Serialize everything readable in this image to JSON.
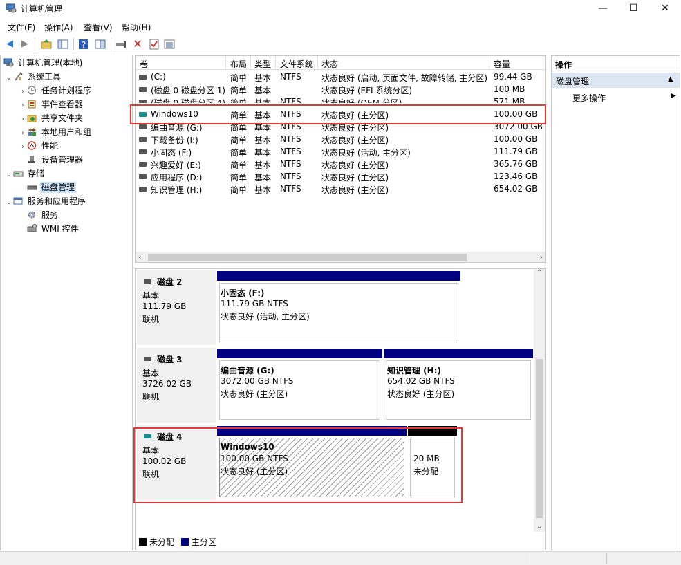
{
  "window": {
    "title": "计算机管理",
    "minimize": "—",
    "maximize": "☐",
    "close": "✕"
  },
  "menu": [
    "文件(F)",
    "操作(A)",
    "查看(V)",
    "帮助(H)"
  ],
  "tree": {
    "root": "计算机管理(本地)",
    "system_tools": "系统工具",
    "task_scheduler": "任务计划程序",
    "event_viewer": "事件查看器",
    "shared_folders": "共享文件夹",
    "local_users": "本地用户和组",
    "performance": "性能",
    "device_manager": "设备管理器",
    "storage": "存储",
    "disk_management": "磁盘管理",
    "services_apps": "服务和应用程序",
    "services": "服务",
    "wmi": "WMI 控件"
  },
  "volume_table": {
    "headers": [
      "卷",
      "布局",
      "类型",
      "文件系统",
      "状态",
      "容量"
    ],
    "rows": [
      {
        "vol": "(C:)",
        "layout": "简单",
        "type": "基本",
        "fs": "NTFS",
        "status": "状态良好 (启动, 页面文件, 故障转储, 主分区)",
        "cap": "99.44 GB"
      },
      {
        "vol": "(磁盘 0 磁盘分区 1)",
        "layout": "简单",
        "type": "基本",
        "fs": "",
        "status": "状态良好 (EFI 系统分区)",
        "cap": "100 MB"
      },
      {
        "vol": "(磁盘 0 磁盘分区 4)",
        "layout": "简单",
        "type": "基本",
        "fs": "NTFS",
        "status": "状态良好 (OEM 分区)",
        "cap": "571 MB"
      },
      {
        "vol": "Windows10",
        "layout": "简单",
        "type": "基本",
        "fs": "NTFS",
        "status": "状态良好 (主分区)",
        "cap": "100.00 GB"
      },
      {
        "vol": "编曲音源 (G:)",
        "layout": "简单",
        "type": "基本",
        "fs": "NTFS",
        "status": "状态良好 (主分区)",
        "cap": "3072.00 GB"
      },
      {
        "vol": "下载备份 (I:)",
        "layout": "简单",
        "type": "基本",
        "fs": "NTFS",
        "status": "状态良好 (主分区)",
        "cap": "100.00 GB"
      },
      {
        "vol": "小固态 (F:)",
        "layout": "简单",
        "type": "基本",
        "fs": "NTFS",
        "status": "状态良好 (活动, 主分区)",
        "cap": "111.79 GB"
      },
      {
        "vol": "兴趣爱好 (E:)",
        "layout": "简单",
        "type": "基本",
        "fs": "NTFS",
        "status": "状态良好 (主分区)",
        "cap": "365.76 GB"
      },
      {
        "vol": "应用程序 (D:)",
        "layout": "简单",
        "type": "基本",
        "fs": "NTFS",
        "status": "状态良好 (主分区)",
        "cap": "123.46 GB"
      },
      {
        "vol": "知识管理 (H:)",
        "layout": "简单",
        "type": "基本",
        "fs": "NTFS",
        "status": "状态良好 (主分区)",
        "cap": "654.02 GB"
      }
    ]
  },
  "disks": {
    "disk2": {
      "name": "磁盘 2",
      "type": "基本",
      "size": "111.79 GB",
      "state": "联机",
      "p1": {
        "name": "小固态  (F:)",
        "size": "111.79 GB NTFS",
        "status": "状态良好 (活动, 主分区)"
      }
    },
    "disk3": {
      "name": "磁盘 3",
      "type": "基本",
      "size": "3726.02 GB",
      "state": "联机",
      "p1": {
        "name": "编曲音源  (G:)",
        "size": "3072.00 GB NTFS",
        "status": "状态良好 (主分区)"
      },
      "p2": {
        "name": "知识管理  (H:)",
        "size": "654.02 GB NTFS",
        "status": "状态良好 (主分区)"
      }
    },
    "disk4": {
      "name": "磁盘 4",
      "type": "基本",
      "size": "100.02 GB",
      "state": "联机",
      "p1": {
        "name": "Windows10",
        "size": "100.00 GB NTFS",
        "status": "状态良好 (主分区)"
      },
      "p2": {
        "size": "20 MB",
        "status": "未分配"
      }
    }
  },
  "legend": {
    "unallocated": "未分配",
    "primary": "主分区"
  },
  "actions": {
    "header": "操作",
    "section": "磁盘管理",
    "more": "更多操作"
  },
  "colors": {
    "primary_partition": "#000080",
    "unallocated": "#000000",
    "highlight": "#e53935"
  }
}
